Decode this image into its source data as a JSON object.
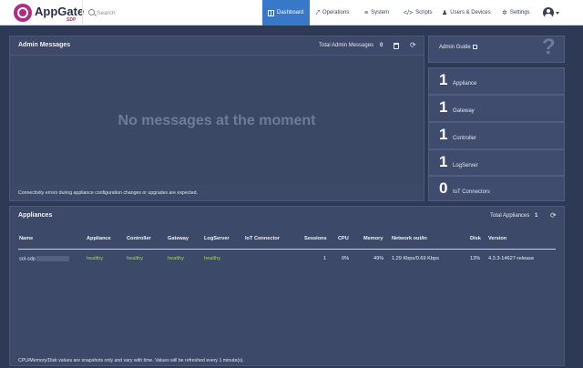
{
  "header": {
    "logo_name": "AppGate",
    "logo_sub": "SDP",
    "search_placeholder": "Search",
    "nav": {
      "dashboard": "Dashboard",
      "operations": "Operations",
      "system": "System",
      "scripts": "Scripts",
      "users_devices": "Users & Devices",
      "settings": "Settings"
    }
  },
  "admin_messages": {
    "title": "Admin Messages",
    "total_label": "Total Admin Messages",
    "total_count": "0",
    "empty_text": "No messages at the moment",
    "footnote": "Connectivity errors during appliance configuration changes or upgrades are expected."
  },
  "side": {
    "admin_guide": "Admin Guide",
    "stats": [
      {
        "count": "1",
        "label": "Appliance"
      },
      {
        "count": "1",
        "label": "Gateway"
      },
      {
        "count": "1",
        "label": "Controller"
      },
      {
        "count": "1",
        "label": "LogServer"
      },
      {
        "count": "0",
        "label": "IoT Connectors"
      }
    ]
  },
  "appliances": {
    "title": "Appliances",
    "total_label": "Total Appliances",
    "total_count": "1",
    "columns": [
      "Name",
      "Appliance",
      "Controller",
      "Gateway",
      "LogServer",
      "IoT Connector",
      "Sessions",
      "CPU",
      "Memory",
      "Network out/in",
      "Disk",
      "Version"
    ],
    "rows": [
      {
        "name": "sol-sdp",
        "appliance": "healthy",
        "controller": "healthy",
        "gateway": "healthy",
        "logserver": "healthy",
        "iot": "",
        "sessions": "1",
        "cpu": "0%",
        "memory": "49%",
        "network": "1.29 Kbps/0.69 Kbps",
        "disk": "13%",
        "version": "4.3.3-14627-release"
      }
    ],
    "footnote": "CPU/Memory/Disk values are snapshots only and vary with time. Values will be refreshed every 1 minute(s)."
  },
  "colors": {
    "brand": "#b32a86",
    "active_nav": "#3778c9",
    "healthy": "#9fd46a",
    "background": "#2e3a55"
  }
}
